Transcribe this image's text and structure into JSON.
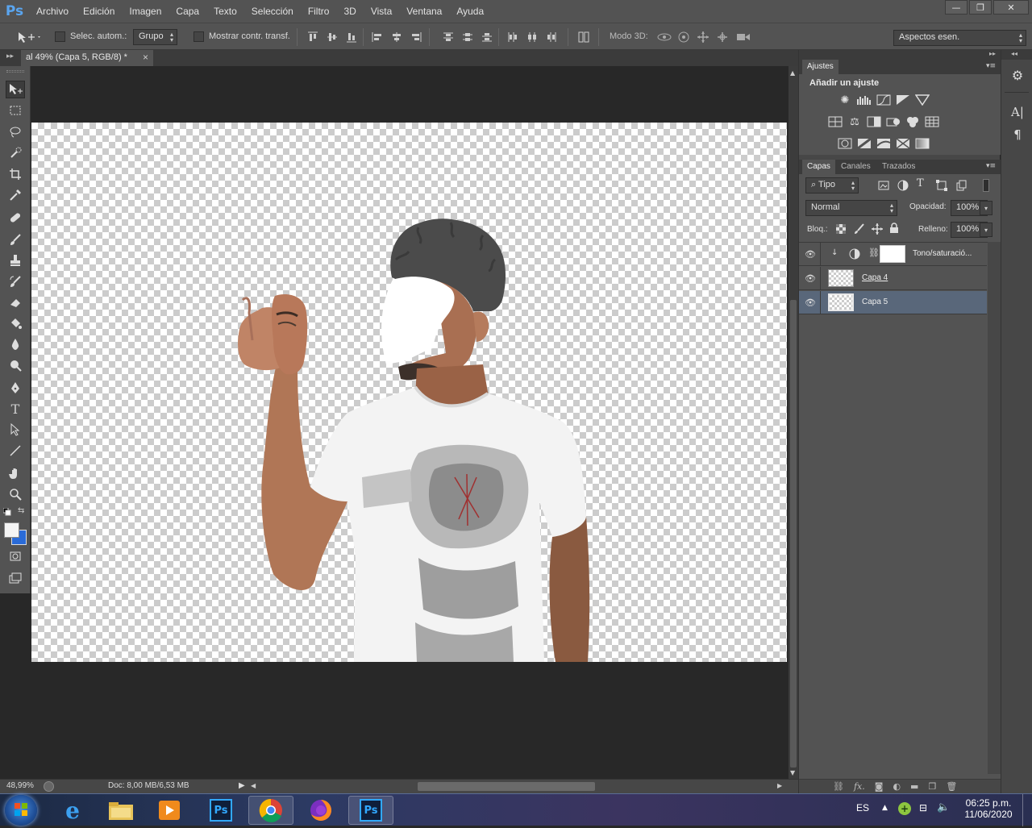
{
  "app": {
    "logo": "Ps",
    "menu": [
      "Archivo",
      "Edición",
      "Imagen",
      "Capa",
      "Texto",
      "Selección",
      "Filtro",
      "3D",
      "Vista",
      "Ventana",
      "Ayuda"
    ],
    "window_controls": [
      "—",
      "❐",
      "✕"
    ]
  },
  "options_bar": {
    "auto_select_label": "Selec. autom.:",
    "auto_select_value": "Grupo",
    "show_transform_label": "Mostrar contr. transf.",
    "mode_3d_label": "Modo 3D:",
    "workspace_value": "Aspectos esen."
  },
  "document": {
    "tab_title": "al 49% (Capa 5, RGB/8) *",
    "tab_close": "×"
  },
  "status": {
    "zoom": "48,99%",
    "doc_info": "Doc: 8,00 MB/6,53 MB"
  },
  "adjustments_panel": {
    "tab": "Ajustes",
    "heading": "Añadir un ajuste",
    "row1": [
      "sun-icon",
      "levels-icon",
      "curves-icon",
      "exposure-icon",
      "vibrance-icon"
    ],
    "row2": [
      "hue-icon",
      "balance-icon",
      "bw-icon",
      "photo-filter-icon",
      "channel-mixer-icon",
      "lookup-icon"
    ],
    "row3": [
      "invert-icon",
      "posterize-icon",
      "threshold-icon",
      "selective-color-icon",
      "gradient-map-icon"
    ]
  },
  "layers_panel": {
    "tabs": [
      "Capas",
      "Canales",
      "Trazados"
    ],
    "filter_value": "Tipo",
    "blend_mode": "Normal",
    "opacity_label": "Opacidad:",
    "opacity_value": "100%",
    "lock_label": "Bloq.:",
    "fill_label": "Relleno:",
    "fill_value": "100%",
    "layers": [
      {
        "name": "Tono/saturació...",
        "type": "adjustment",
        "visible": true,
        "selected": false
      },
      {
        "name": "Capa 4",
        "type": "pixel",
        "visible": true,
        "selected": false
      },
      {
        "name": "Capa 5",
        "type": "pixel",
        "visible": true,
        "selected": true
      }
    ]
  },
  "taskbar": {
    "language": "ES",
    "time": "06:25 p.m.",
    "date": "11/06/2020",
    "apps": [
      "windows-start",
      "internet-explorer",
      "file-explorer",
      "media-player",
      "photoshop-pinned",
      "chrome",
      "firefox",
      "photoshop-active"
    ]
  }
}
